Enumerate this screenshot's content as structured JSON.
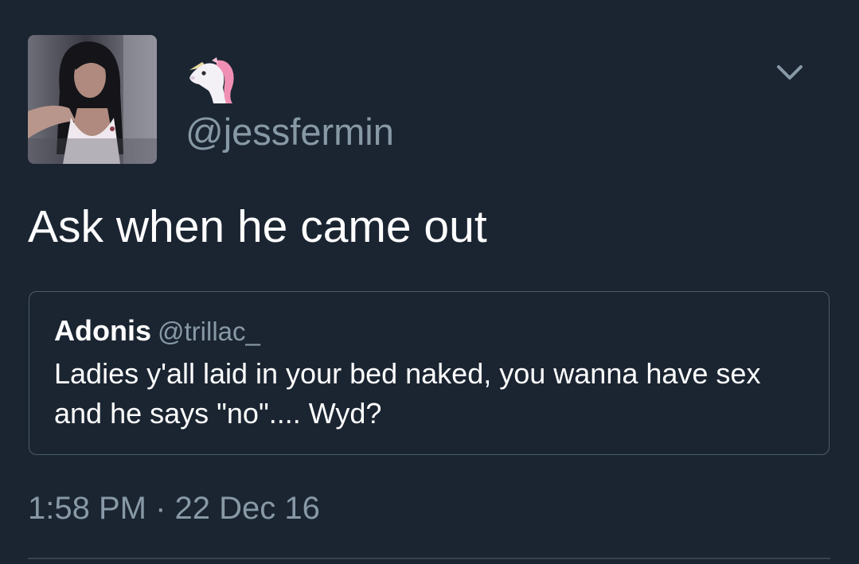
{
  "tweet": {
    "avatar_icon": "profile-photo",
    "display_name_emoji_icon": "unicorn-icon",
    "handle": "@jessfermin",
    "text": "Ask when he came out",
    "timestamp": "1:58 PM · 22 Dec 16",
    "menu_icon": "chevron-down-icon"
  },
  "quoted": {
    "name": "Adonis",
    "handle": "@trillac_",
    "text": "Ladies y'all laid in your bed naked, you wanna have sex and he says \"no\".... Wyd?"
  },
  "colors": {
    "background": "#1b2532",
    "secondary_text": "#8899a6",
    "primary_text": "#ffffff",
    "border": "#4b5b6b"
  }
}
